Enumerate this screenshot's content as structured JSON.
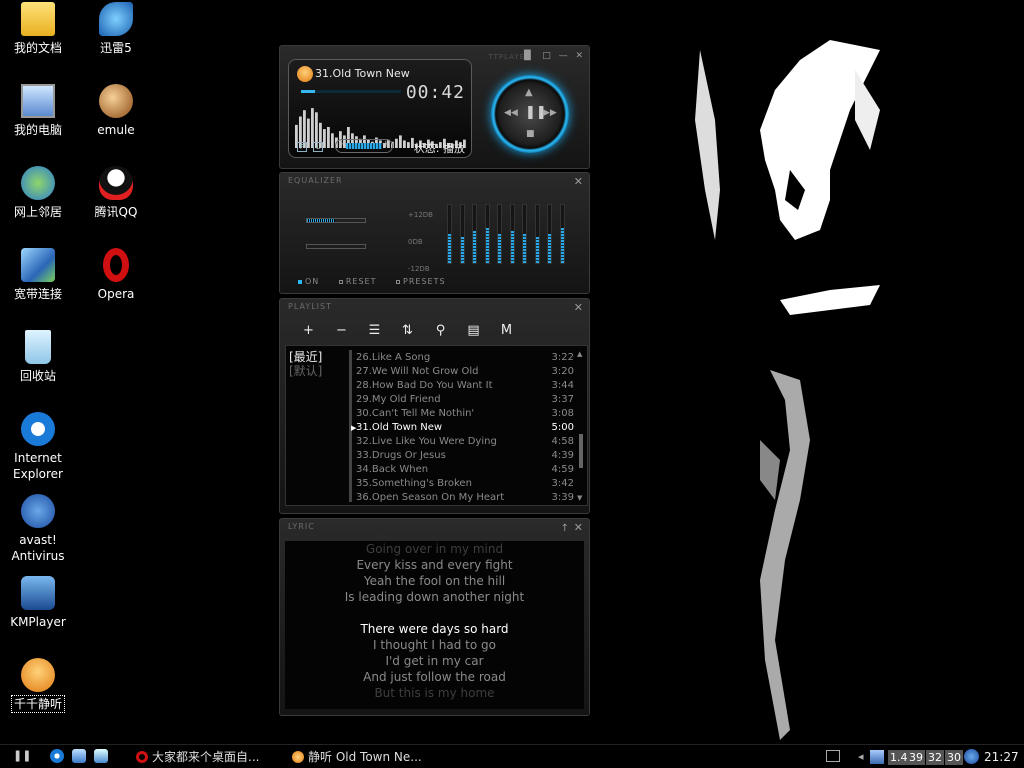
{
  "desktop_icons": [
    {
      "label": "我的文档",
      "icon": "my-documents-icon"
    },
    {
      "label": "迅雷5",
      "icon": "thunder-icon"
    },
    {
      "label": "我的电脑",
      "icon": "my-computer-icon"
    },
    {
      "label": "emule",
      "icon": "emule-icon"
    },
    {
      "label": "网上邻居",
      "icon": "network-places-icon"
    },
    {
      "label": "腾讯QQ",
      "icon": "qq-icon"
    },
    {
      "label": "宽带连接",
      "icon": "broadband-icon"
    },
    {
      "label": "Opera",
      "icon": "opera-icon"
    },
    {
      "label": "回收站",
      "icon": "recycle-bin-icon"
    },
    {
      "label": "Internet\nExplorer",
      "icon": "ie-icon"
    },
    {
      "label": "avast!\nAntivirus",
      "icon": "avast-icon"
    },
    {
      "label": "KMPlayer",
      "icon": "kmplayer-icon"
    },
    {
      "label": "千千静听",
      "icon": "ttplayer-icon"
    }
  ],
  "player": {
    "brand": "TTPLAYER",
    "now_playing": "31.Old Town New",
    "time": "00:42",
    "status": "状态: 播放",
    "progress": 0.14,
    "volume": 0.65,
    "mode_p": "P",
    "mode_l": "L",
    "vol_minus": "−",
    "vol_plus": "+",
    "spectrum": [
      0.55,
      0.75,
      0.9,
      0.7,
      0.95,
      0.85,
      0.6,
      0.45,
      0.5,
      0.35,
      0.25,
      0.4,
      0.3,
      0.5,
      0.35,
      0.28,
      0.22,
      0.3,
      0.2,
      0.15,
      0.25,
      0.18,
      0.12,
      0.2,
      0.15,
      0.22,
      0.3,
      0.18,
      0.14,
      0.24,
      0.1,
      0.18,
      0.12,
      0.2,
      0.16,
      0.1,
      0.14,
      0.22,
      0.12,
      0.1,
      0.18,
      0.14,
      0.2
    ],
    "window_buttons": [
      "▐▌",
      "□",
      "—",
      "✕"
    ],
    "controls": {
      "up": "▲",
      "prev": "◀◀",
      "pause": "❚❚",
      "next": "▶▶",
      "stop": "■"
    },
    "accent": "#2ab8f5"
  },
  "equalizer": {
    "title": "EQUALIZER",
    "scale": [
      "+12DB",
      "0DB",
      "-12DB"
    ],
    "bands": [
      0.5,
      0.45,
      0.55,
      0.6,
      0.5,
      0.55,
      0.5,
      0.45,
      0.5,
      0.6
    ],
    "options": [
      {
        "label": "ON",
        "on": true
      },
      {
        "label": "RESET",
        "on": false
      },
      {
        "label": "PRESETS",
        "on": false
      }
    ]
  },
  "playlist": {
    "title": "PLAYLIST",
    "toolbar": [
      {
        "glyph": "+",
        "icon": "add-icon"
      },
      {
        "glyph": "−",
        "icon": "remove-icon"
      },
      {
        "glyph": "☰",
        "icon": "list-icon"
      },
      {
        "glyph": "⇅",
        "icon": "sort-icon"
      },
      {
        "glyph": "⚲",
        "icon": "search-icon"
      },
      {
        "glyph": "▤",
        "icon": "file-icon"
      },
      {
        "glyph": "M",
        "icon": "mode-icon"
      }
    ],
    "groups": [
      {
        "label": "[最近]",
        "active": true
      },
      {
        "label": "[默认]",
        "active": false
      }
    ],
    "tracks": [
      {
        "title": "26.Like A Song",
        "duration": "3:22"
      },
      {
        "title": "27.We Will Not Grow Old",
        "duration": "3:20"
      },
      {
        "title": "28.How Bad Do You Want It",
        "duration": "3:44"
      },
      {
        "title": "29.My Old Friend",
        "duration": "3:37"
      },
      {
        "title": "30.Can't Tell Me Nothin'",
        "duration": "3:08"
      },
      {
        "title": "31.Old Town New",
        "duration": "5:00",
        "current": true
      },
      {
        "title": "32.Live Like You Were Dying",
        "duration": "4:58"
      },
      {
        "title": "33.Drugs Or Jesus",
        "duration": "4:39"
      },
      {
        "title": "34.Back When",
        "duration": "4:59"
      },
      {
        "title": "35.Something's Broken",
        "duration": "3:42"
      },
      {
        "title": "36.Open Season On My Heart",
        "duration": "3:39"
      }
    ]
  },
  "lyric": {
    "title": "LYRIC",
    "lines": [
      {
        "text": "Going over in my mind",
        "state": "faded"
      },
      {
        "text": "Every kiss and every fight",
        "state": "normal"
      },
      {
        "text": "Yeah the fool on the hill",
        "state": "normal"
      },
      {
        "text": "Is leading down another night",
        "state": "normal"
      },
      {
        "text": "",
        "state": "gap"
      },
      {
        "text": "There were days so hard",
        "state": "active"
      },
      {
        "text": "I thought I had to go",
        "state": "normal"
      },
      {
        "text": "I'd get in my car",
        "state": "normal"
      },
      {
        "text": "And just follow the road",
        "state": "normal"
      },
      {
        "text": "But this is my home",
        "state": "faded"
      }
    ]
  },
  "taskbar": {
    "start": "❚❚",
    "tasks": [
      {
        "label": "大家都来个桌面自...",
        "icon": "opera-icon"
      },
      {
        "label": "静听   Old Town Ne...",
        "icon": "ttplayer-icon"
      }
    ],
    "tray_numbers": [
      "1.4",
      "39",
      "32",
      "30"
    ],
    "clock": "21:27"
  }
}
